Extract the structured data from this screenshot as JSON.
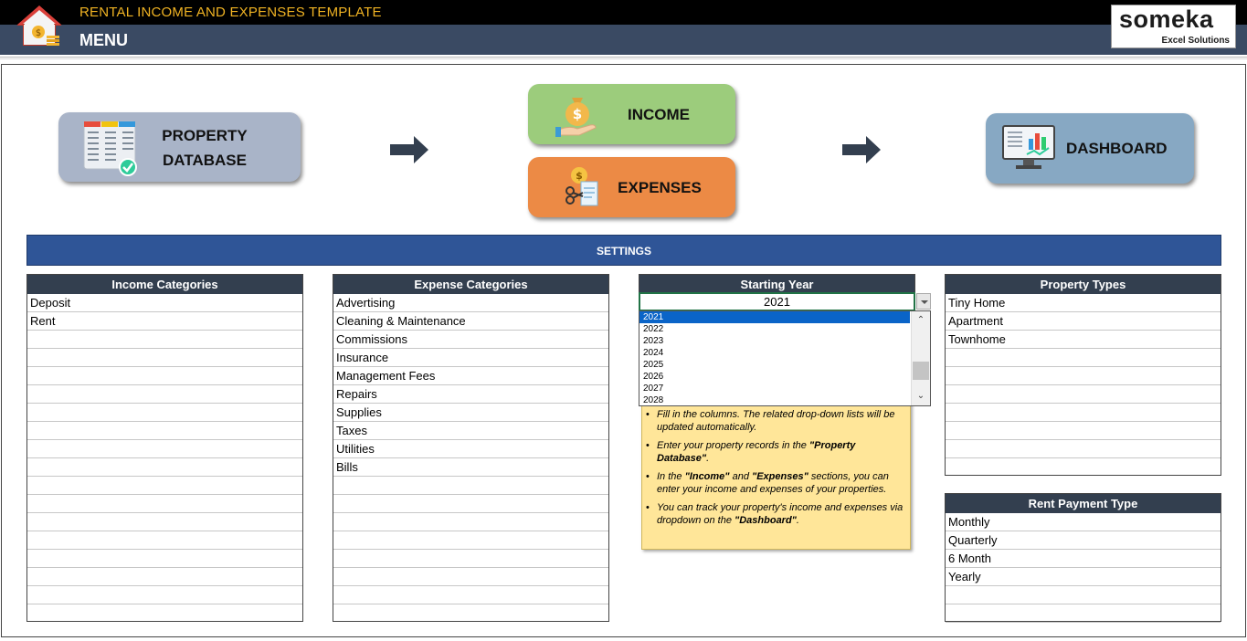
{
  "header": {
    "app_title": "RENTAL INCOME AND EXPENSES TEMPLATE",
    "menu_label": "MENU",
    "logo_main": "someka",
    "logo_sub": "Excel Solutions"
  },
  "nav": {
    "property_db_line1": "PROPERTY",
    "property_db_line2": "DATABASE",
    "income": "INCOME",
    "expenses": "EXPENSES",
    "dashboard": "DASHBOARD"
  },
  "settings": {
    "title": "SETTINGS",
    "income_categories": {
      "header": "Income Categories",
      "items": [
        "Deposit",
        "Rent",
        "",
        "",
        "",
        "",
        "",
        "",
        "",
        "",
        "",
        "",
        "",
        "",
        "",
        "",
        "",
        ""
      ]
    },
    "expense_categories": {
      "header": "Expense Categories",
      "items": [
        "Advertising",
        "Cleaning & Maintenance",
        "Commissions",
        "Insurance",
        "Management Fees",
        "Repairs",
        "Supplies",
        "Taxes",
        "Utilities",
        "Bills",
        "",
        "",
        "",
        "",
        "",
        "",
        "",
        ""
      ]
    },
    "starting_year": {
      "header": "Starting Year",
      "value": "2021",
      "options": [
        "2021",
        "2022",
        "2023",
        "2024",
        "2025",
        "2026",
        "2027",
        "2028"
      ]
    },
    "property_types": {
      "header": "Property Types",
      "items": [
        "Tiny Home",
        "Apartment",
        "Townhome",
        "",
        "",
        "",
        "",
        "",
        "",
        ""
      ]
    },
    "rent_payment_type": {
      "header": "Rent Payment Type",
      "items": [
        "Monthly",
        "Quarterly",
        "6 Month",
        "Yearly",
        "",
        "",
        ""
      ]
    },
    "notes": {
      "n1": "Fill in the columns. The related drop-down lists will be updated automatically.",
      "n2_pre": "Enter your property records in the ",
      "n2_bold": "\"Property Database\"",
      "n2_post": ".",
      "n3_pre": "In the ",
      "n3_bold1": "\"Income\"",
      "n3_mid": " and ",
      "n3_bold2": "\"Expenses\"",
      "n3_post": " sections, you can enter your income and expenses of your properties.",
      "n4_pre": "You can track your property's income and expenses via dropdown on the ",
      "n4_bold": "\"Dashboard\"",
      "n4_post": "."
    }
  },
  "colors": {
    "header_bg": "#3a4a63",
    "title_accent": "#f0b323",
    "settings_bar": "#2f5597",
    "table_header": "#333f4f",
    "income_btn": "#9ccc7c",
    "expenses_btn": "#ec8a45",
    "dashboard_btn": "#87a8c3",
    "database_btn": "#a9b4c8",
    "note_bg": "#ffe699"
  }
}
